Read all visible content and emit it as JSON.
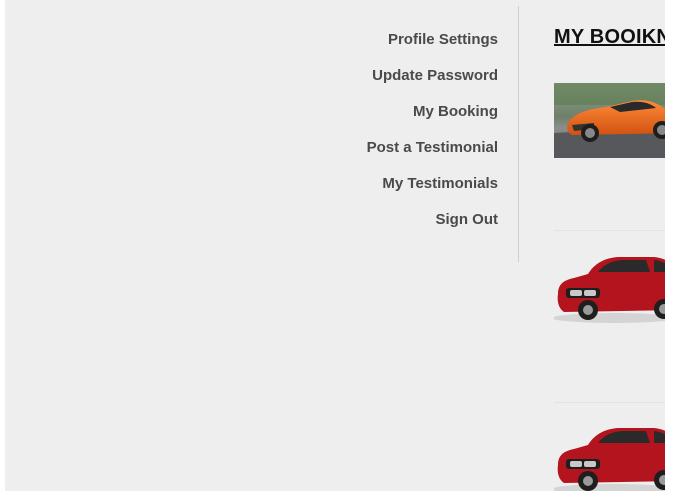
{
  "sidebar": {
    "items": [
      {
        "label": "Profile Settings"
      },
      {
        "label": "Update Password"
      },
      {
        "label": "My Booking"
      },
      {
        "label": "Post a Testimonial"
      },
      {
        "label": "My Testimonials"
      },
      {
        "label": "Sign Out"
      }
    ]
  },
  "main": {
    "title": "MY BOOIKNGS",
    "bookings": [
      {
        "car_color": "#e8641c"
      },
      {
        "car_color": "#b3141e"
      },
      {
        "car_color": "#b3141e"
      }
    ]
  },
  "colors": {
    "panel_bg": "#eeeeee",
    "menu_text": "#4a4a4a",
    "title_text": "#111111"
  }
}
